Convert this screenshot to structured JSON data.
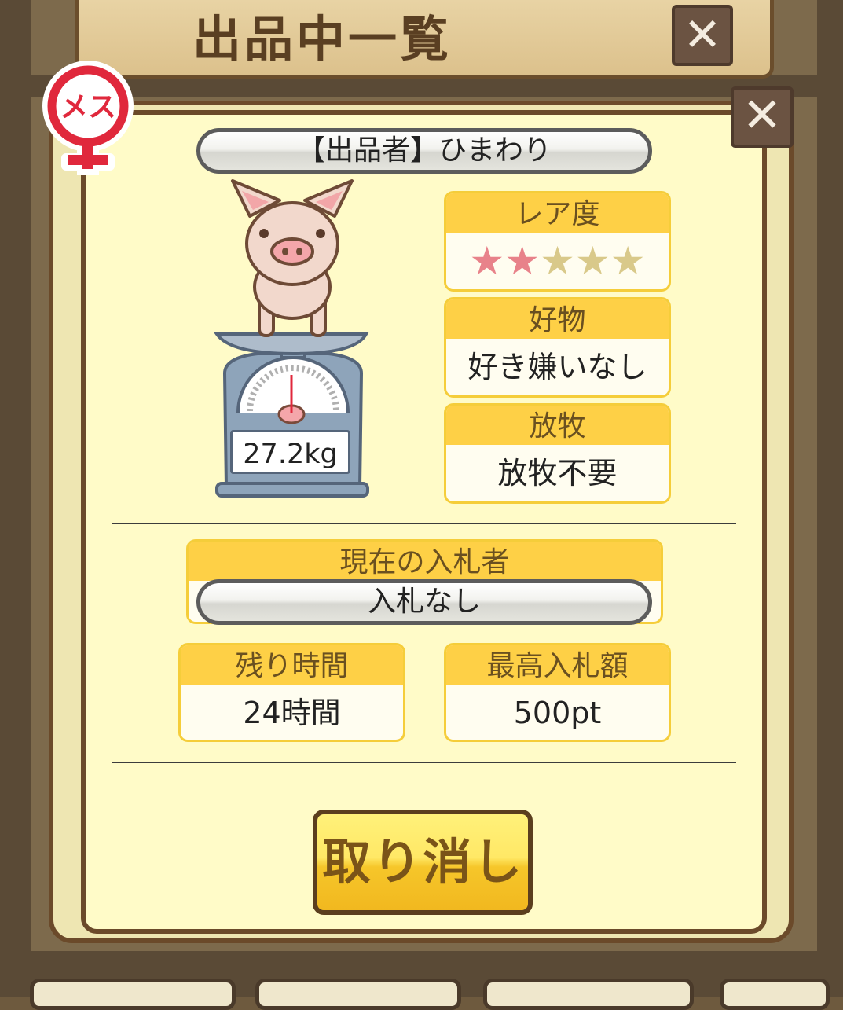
{
  "screen": {
    "title": "出品中一覧",
    "title_close": "✕",
    "dialog_close": "✕"
  },
  "listing": {
    "gender_label": "メス",
    "seller_text": "【出品者】ひまわり",
    "weight": "27.2kg",
    "rarity": {
      "label": "レア度",
      "stars_filled": 2,
      "stars_total": 5
    },
    "favorite_food": {
      "label": "好物",
      "value": "好き嫌いなし"
    },
    "grazing": {
      "label": "放牧",
      "value": "放牧不要"
    },
    "current_bidder": {
      "label": "現在の入札者",
      "value": "入札なし"
    },
    "time_left": {
      "label": "残り時間",
      "value": "24時間"
    },
    "highest_bid": {
      "label": "最高入札額",
      "value": "500pt"
    }
  },
  "actions": {
    "cancel_label": "取り消し"
  },
  "colors": {
    "box_header": "#fed046",
    "star_filled": "#e8828a",
    "star_empty": "#d9c98a",
    "gender_red": "#e0283c",
    "button_yellow": "#f6c62a"
  }
}
